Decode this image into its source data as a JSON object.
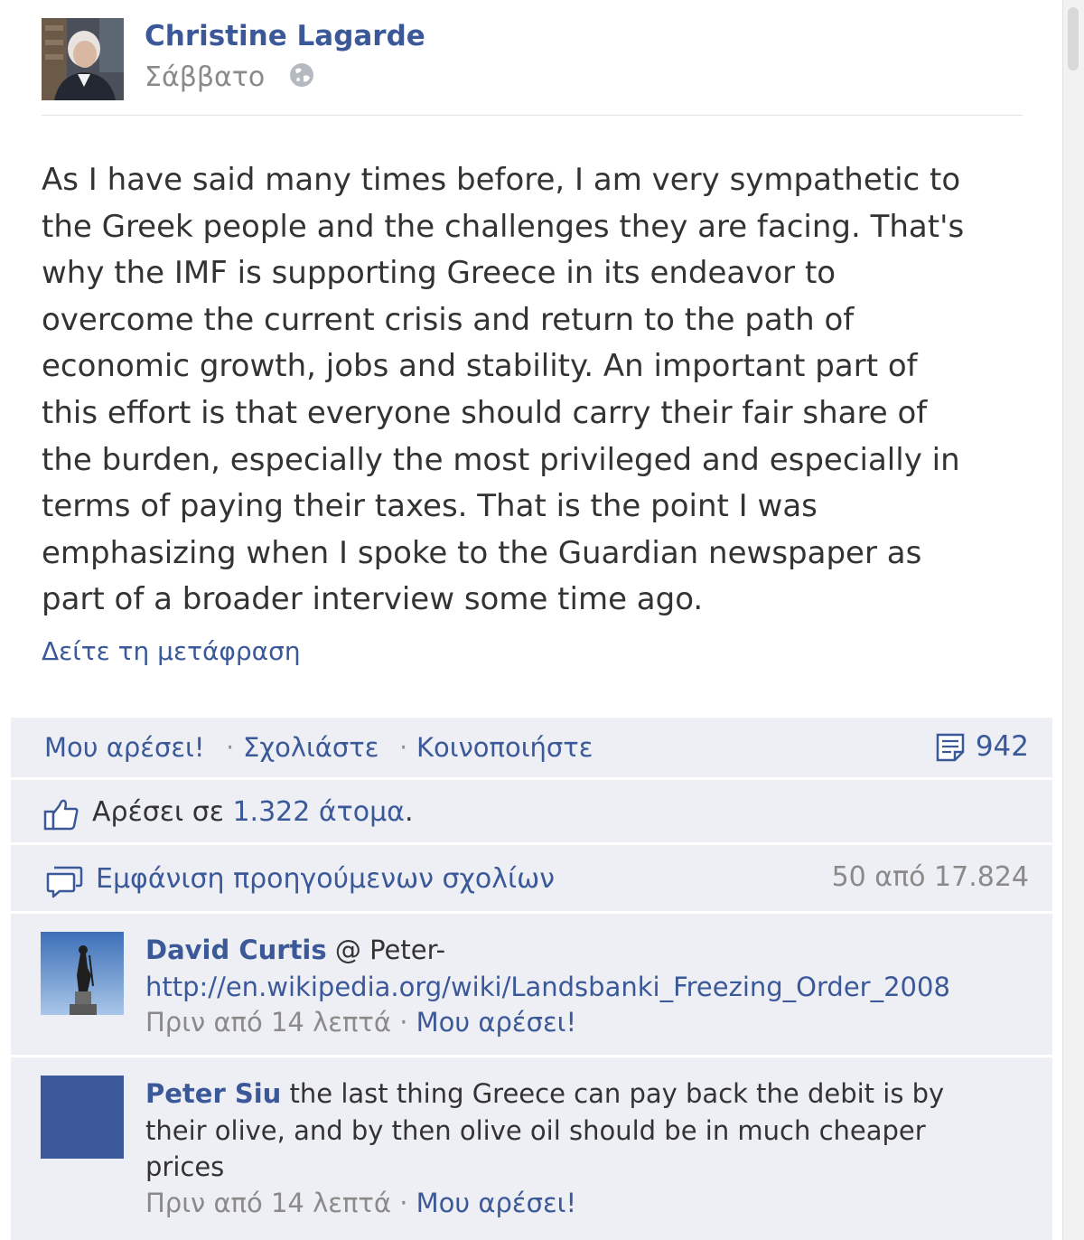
{
  "post": {
    "author": "Christine Lagarde",
    "timestamp": "Σάββατο",
    "privacy_icon": "globe-icon",
    "text": "As I have said many times before, I am very sympathetic to\nthe Greek people and the challenges they are facing. That's\nwhy the IMF is supporting Greece in its endeavor to\novercome the current crisis and return to the path of\neconomic growth, jobs and stability. An important part of\nthis effort is that everyone should carry their fair share of\nthe burden, especially the most privileged and especially in\nterms of paying their taxes. That is the point I was\nemphasizing when I spoke to the Guardian newspaper as\npart of a broader interview some time ago.",
    "translate_label": "Δείτε τη μετάφραση"
  },
  "actions": {
    "like_label": "Μου αρέσει!",
    "comment_label": "Σχολιάστε",
    "share_label": "Κοινοποιήστε",
    "separator": "·",
    "share_count": "942"
  },
  "likes": {
    "prefix": "Αρέσει σε ",
    "count": "1.322 άτομα",
    "suffix": "."
  },
  "previous_comments": {
    "label": "Εμφάνιση προηγούμενων σχολίων",
    "count": "50 από 17.824"
  },
  "comments": [
    {
      "author": "David Curtis",
      "text_prefix": " @ Peter-",
      "link_text": "http://en.wikipedia.org/wiki/Landsbanki_Freezing_Order_2008",
      "time": "Πριν από 14 λεπτά",
      "separator": "·",
      "like_label": "Μου αρέσει!"
    },
    {
      "author": "Peter Siu",
      "text": " the last thing Greece can pay back the debit is by their olive, and by then olive oil should be in much cheaper prices",
      "time": "Πριν από 14 λεπτά",
      "separator": "·",
      "like_label": "Μου αρέσει!"
    }
  ],
  "colors": {
    "link_blue": "#3b5998",
    "ufi_background": "#edeff4",
    "meta_gray": "#8a8a8a"
  }
}
